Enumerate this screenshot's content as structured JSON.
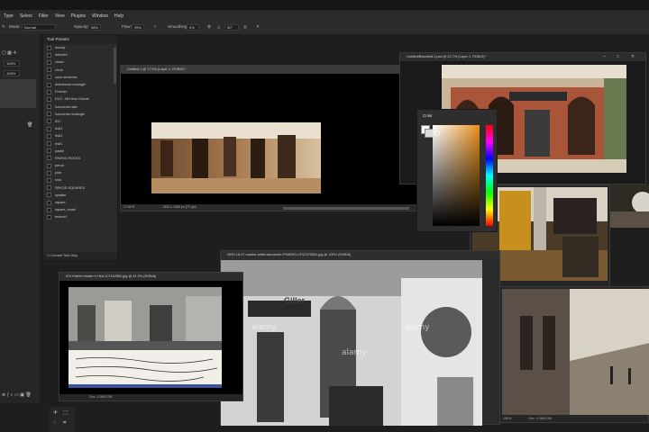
{
  "menu": [
    "Type",
    "Select",
    "Filter",
    "View",
    "Plugins",
    "Window",
    "Help"
  ],
  "options": {
    "mode_label": "Mode:",
    "mode_value": "Normal",
    "opacity_label": "Opacity:",
    "opacity_value": "98%",
    "flow_label": "Flow:",
    "flow_value": "99%",
    "smoothing_label": "Smoothing:",
    "smoothing_value": "0%",
    "angle_value": "90°"
  },
  "left_panel": {
    "pct1": "100%",
    "pct2": "100%"
  },
  "tool_presets": {
    "title": "Tool Presets",
    "items": [
      "mondy",
      "defreshi",
      "chisel",
      "circle",
      "color stretches",
      "directional rectangle",
      "Fresher",
      "DLO - MH flow Grizzle",
      "horizontal rake",
      "horizontal rectangle",
      "IDJ",
      "leaf1",
      "leaf1",
      "leaf1",
      "pastel",
      "PAVING ROCKS",
      "pencil",
      "pine",
      "rock",
      "SRKOD SQUARES",
      "splatter",
      "square",
      "square_small",
      "texture1"
    ],
    "current_only": "Current Tool Only"
  },
  "windows": {
    "untitled": {
      "title": "Untitled-1 @ 17.6% (Layer 1, RGB/8) *",
      "zoom": "17.62%",
      "doc": "1920 x 1080 px (72 ppi)"
    },
    "building": {
      "title": "Untitled/Bannfeld-1.psd @ 22.7% (Layer 1, RGB/8) *"
    },
    "color": {
      "title": "Color"
    },
    "photo": {
      "zoom": "26.67%"
    },
    "corner": {
      "title": "2990-16-07-marthe-stiftet-alexander-PH89HD-CF62370551.jpg @ 100% (RGB/8)"
    },
    "postcard": {
      "title": "87c+Harth+estate+1+fed-107162560.jpg @ 81.9% (RGB/8)",
      "doc": "Doc: 1.0M/2.0M"
    },
    "street": {
      "zoom": "100%",
      "doc": "Doc: 1.0M/2.0M"
    }
  },
  "watermark": "alamy",
  "shop_sign": "Giller"
}
